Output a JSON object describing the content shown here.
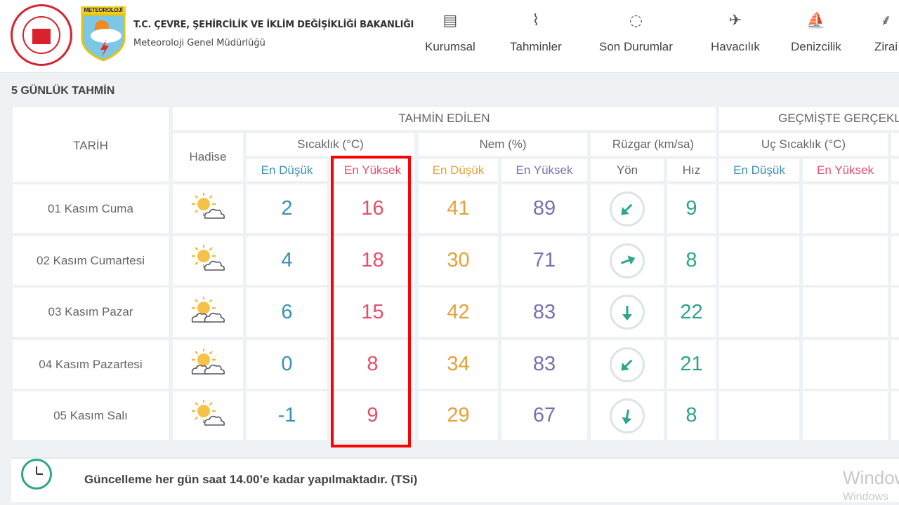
{
  "header": {
    "org_line1": "T.C. ÇEVRE, ŞEHİRCİLİK VE İKLİM DEĞİŞİKLİĞİ BAKANLIĞI",
    "org_line2": "Meteoroloji Genel Müdürlüğü",
    "logo2_text": "METEOROLOJİ",
    "nav": [
      {
        "label": "Kurumsal",
        "icon": "document-icon"
      },
      {
        "label": "Tahminler",
        "icon": "chart-icon"
      },
      {
        "label": "Son Durumlar",
        "icon": "check-circle-icon"
      },
      {
        "label": "Havacılık",
        "icon": "airplane-icon"
      },
      {
        "label": "Denizcilik",
        "icon": "sailboat-icon"
      },
      {
        "label": "Zirai",
        "icon": "wheat-icon"
      }
    ]
  },
  "page_title": "5 GÜNLÜK TAHMİN",
  "table": {
    "group_forecast": "TAHMİN EDİLEN",
    "group_past": "GEÇMİŞTE GERÇEKLEŞEN",
    "date_header": "TARİH",
    "event_header": "Hadise",
    "temp_header": "Sıcaklık (°C)",
    "hum_header": "Nem (%)",
    "wind_header": "Rüzgar (km/sa)",
    "extreme_header": "Uç Sıcaklık (°C)",
    "low": "En Düşük",
    "high": "En Yüksek",
    "dir": "Yön",
    "speed": "Hız",
    "rows": [
      {
        "date": "01 Kasım Cuma",
        "icon": "partly-cloudy-icon",
        "tmin": "2",
        "tmax": "16",
        "hmin": "41",
        "hmax": "89",
        "wind_dir_deg": 225,
        "wind": "9"
      },
      {
        "date": "02 Kasım Cumartesi",
        "icon": "partly-cloudy-icon",
        "tmin": "4",
        "tmax": "18",
        "hmin": "30",
        "hmax": "71",
        "wind_dir_deg": 70,
        "wind": "8"
      },
      {
        "date": "03 Kasım Pazar",
        "icon": "mostly-cloudy-icon",
        "tmin": "6",
        "tmax": "15",
        "hmin": "42",
        "hmax": "83",
        "wind_dir_deg": 180,
        "wind": "22"
      },
      {
        "date": "04 Kasım Pazartesi",
        "icon": "mostly-cloudy-icon",
        "tmin": "0",
        "tmax": "8",
        "hmin": "34",
        "hmax": "83",
        "wind_dir_deg": 225,
        "wind": "21"
      },
      {
        "date": "05 Kasım Salı",
        "icon": "partly-cloudy-icon",
        "tmin": "-1",
        "tmax": "9",
        "hmin": "29",
        "hmax": "67",
        "wind_dir_deg": 190,
        "wind": "8"
      }
    ]
  },
  "footer": {
    "note": "Güncelleme her gün saat 14.00’e kadar yapılmaktadır. (TSi)"
  },
  "watermark": {
    "line1": "Windows",
    "line2": "Windows"
  },
  "colors": {
    "low": "#3a8fb7",
    "high": "#e4506b",
    "hum_low": "#e4a23a",
    "hum_high": "#7a6fb2",
    "wind": "#2ea58a",
    "highlight": "#ff0000"
  }
}
